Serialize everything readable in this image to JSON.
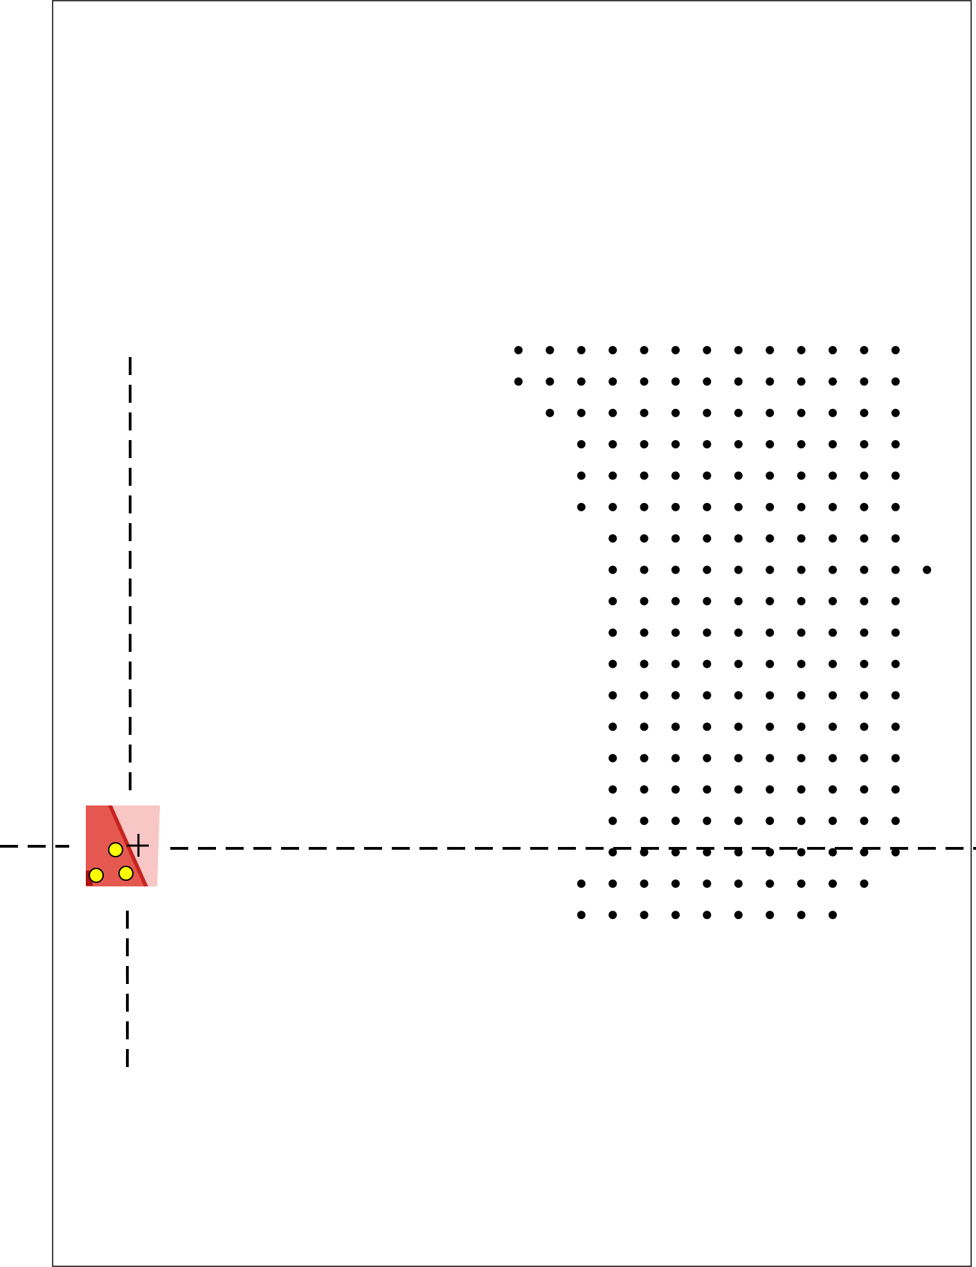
{
  "colors": {
    "background": "#ffffff",
    "frame_stroke": "#000000",
    "grid_dot": "#000000",
    "guide_line": "#000000",
    "thumbnail_light": "#f9c6c6",
    "thumbnail_dark": "#e5584f",
    "marker_fill": "#ffff00",
    "marker_stroke": "#000000",
    "crosshair": "#000000"
  },
  "dot_grid": {
    "columns": 14,
    "row_column_ranges": [
      [
        0,
        12
      ],
      [
        0,
        12
      ],
      [
        1,
        12
      ],
      [
        2,
        12
      ],
      [
        2,
        12
      ],
      [
        2,
        12
      ],
      [
        3,
        12
      ],
      [
        3,
        13
      ],
      [
        3,
        12
      ],
      [
        3,
        12
      ],
      [
        3,
        12
      ],
      [
        3,
        12
      ],
      [
        3,
        12
      ],
      [
        3,
        12
      ],
      [
        3,
        12
      ],
      [
        3,
        12
      ],
      [
        3,
        12
      ],
      [
        2,
        11
      ],
      [
        2,
        10
      ]
    ]
  },
  "thumbnail": {
    "icon": "tissue-sample-thumbnail",
    "marker_count": 3,
    "has_crosshair": true
  },
  "guides": {
    "vertical": "dashed",
    "horizontal": "dashed"
  }
}
